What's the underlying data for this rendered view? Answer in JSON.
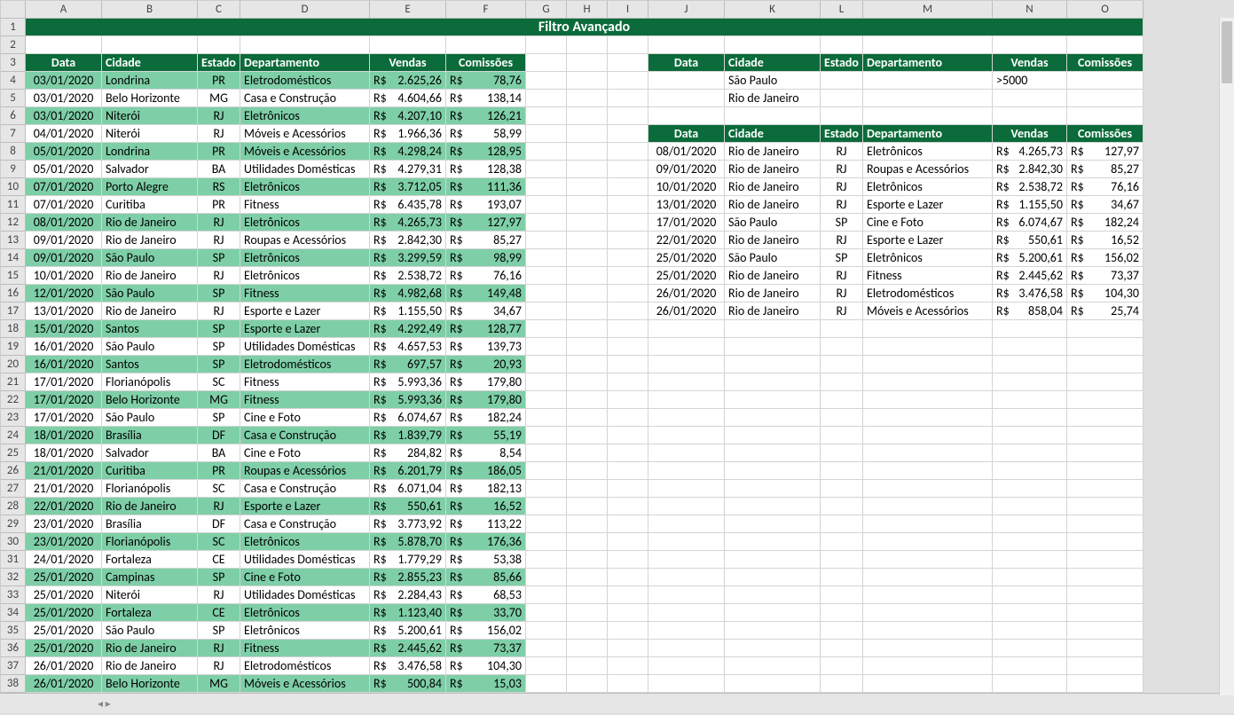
{
  "title": "Filtro Avançado",
  "columns": [
    "A",
    "B",
    "C",
    "D",
    "E",
    "F",
    "G",
    "H",
    "I",
    "J",
    "K",
    "L",
    "M",
    "N",
    "O"
  ],
  "rowCount": 38,
  "headers": [
    "Data",
    "Cidade",
    "Estado",
    "Departamento",
    "Vendas",
    "Comissões"
  ],
  "mainRows": [
    {
      "date": "03/01/2020",
      "city": "Londrina",
      "state": "PR",
      "dept": "Eletrodomésticos",
      "sales": "2.625,26",
      "comm": "78,76",
      "g": true
    },
    {
      "date": "03/01/2020",
      "city": "Belo Horizonte",
      "state": "MG",
      "dept": "Casa e Construção",
      "sales": "4.604,66",
      "comm": "138,14",
      "g": false
    },
    {
      "date": "03/01/2020",
      "city": "Niterói",
      "state": "RJ",
      "dept": "Eletrônicos",
      "sales": "4.207,10",
      "comm": "126,21",
      "g": true
    },
    {
      "date": "04/01/2020",
      "city": "Niterói",
      "state": "RJ",
      "dept": "Móveis e Acessórios",
      "sales": "1.966,36",
      "comm": "58,99",
      "g": false
    },
    {
      "date": "05/01/2020",
      "city": "Londrina",
      "state": "PR",
      "dept": "Móveis e Acessórios",
      "sales": "4.298,24",
      "comm": "128,95",
      "g": true
    },
    {
      "date": "05/01/2020",
      "city": "Salvador",
      "state": "BA",
      "dept": "Utilidades Domésticas",
      "sales": "4.279,31",
      "comm": "128,38",
      "g": false
    },
    {
      "date": "07/01/2020",
      "city": "Porto Alegre",
      "state": "RS",
      "dept": "Eletrônicos",
      "sales": "3.712,05",
      "comm": "111,36",
      "g": true
    },
    {
      "date": "07/01/2020",
      "city": "Curitiba",
      "state": "PR",
      "dept": "Fitness",
      "sales": "6.435,78",
      "comm": "193,07",
      "g": false
    },
    {
      "date": "08/01/2020",
      "city": "Rio de Janeiro",
      "state": "RJ",
      "dept": "Eletrônicos",
      "sales": "4.265,73",
      "comm": "127,97",
      "g": true
    },
    {
      "date": "09/01/2020",
      "city": "Rio de Janeiro",
      "state": "RJ",
      "dept": "Roupas e Acessórios",
      "sales": "2.842,30",
      "comm": "85,27",
      "g": false
    },
    {
      "date": "09/01/2020",
      "city": "São Paulo",
      "state": "SP",
      "dept": "Eletrônicos",
      "sales": "3.299,59",
      "comm": "98,99",
      "g": true
    },
    {
      "date": "10/01/2020",
      "city": "Rio de Janeiro",
      "state": "RJ",
      "dept": "Eletrônicos",
      "sales": "2.538,72",
      "comm": "76,16",
      "g": false
    },
    {
      "date": "12/01/2020",
      "city": "São Paulo",
      "state": "SP",
      "dept": "Fitness",
      "sales": "4.982,68",
      "comm": "149,48",
      "g": true
    },
    {
      "date": "13/01/2020",
      "city": "Rio de Janeiro",
      "state": "RJ",
      "dept": "Esporte e Lazer",
      "sales": "1.155,50",
      "comm": "34,67",
      "g": false
    },
    {
      "date": "15/01/2020",
      "city": "Santos",
      "state": "SP",
      "dept": "Esporte e Lazer",
      "sales": "4.292,49",
      "comm": "128,77",
      "g": true
    },
    {
      "date": "16/01/2020",
      "city": "São Paulo",
      "state": "SP",
      "dept": "Utilidades Domésticas",
      "sales": "4.657,53",
      "comm": "139,73",
      "g": false
    },
    {
      "date": "16/01/2020",
      "city": "Santos",
      "state": "SP",
      "dept": "Eletrodomésticos",
      "sales": "697,57",
      "comm": "20,93",
      "g": true
    },
    {
      "date": "17/01/2020",
      "city": "Florianópolis",
      "state": "SC",
      "dept": "Fitness",
      "sales": "5.993,36",
      "comm": "179,80",
      "g": false
    },
    {
      "date": "17/01/2020",
      "city": "Belo Horizonte",
      "state": "MG",
      "dept": "Fitness",
      "sales": "5.993,36",
      "comm": "179,80",
      "g": true
    },
    {
      "date": "17/01/2020",
      "city": "São Paulo",
      "state": "SP",
      "dept": "Cine e Foto",
      "sales": "6.074,67",
      "comm": "182,24",
      "g": false
    },
    {
      "date": "18/01/2020",
      "city": "Brasília",
      "state": "DF",
      "dept": "Casa e Construção",
      "sales": "1.839,79",
      "comm": "55,19",
      "g": true
    },
    {
      "date": "18/01/2020",
      "city": "Salvador",
      "state": "BA",
      "dept": "Cine e Foto",
      "sales": "284,82",
      "comm": "8,54",
      "g": false
    },
    {
      "date": "21/01/2020",
      "city": "Curitiba",
      "state": "PR",
      "dept": "Roupas e Acessórios",
      "sales": "6.201,79",
      "comm": "186,05",
      "g": true
    },
    {
      "date": "21/01/2020",
      "city": "Florianópolis",
      "state": "SC",
      "dept": "Casa e Construção",
      "sales": "6.071,04",
      "comm": "182,13",
      "g": false
    },
    {
      "date": "22/01/2020",
      "city": "Rio de Janeiro",
      "state": "RJ",
      "dept": "Esporte e Lazer",
      "sales": "550,61",
      "comm": "16,52",
      "g": true
    },
    {
      "date": "23/01/2020",
      "city": "Brasília",
      "state": "DF",
      "dept": "Casa e Construção",
      "sales": "3.773,92",
      "comm": "113,22",
      "g": false
    },
    {
      "date": "23/01/2020",
      "city": "Florianópolis",
      "state": "SC",
      "dept": "Eletrônicos",
      "sales": "5.878,70",
      "comm": "176,36",
      "g": true
    },
    {
      "date": "24/01/2020",
      "city": "Fortaleza",
      "state": "CE",
      "dept": "Utilidades Domésticas",
      "sales": "1.779,29",
      "comm": "53,38",
      "g": false
    },
    {
      "date": "25/01/2020",
      "city": "Campinas",
      "state": "SP",
      "dept": "Cine e Foto",
      "sales": "2.855,23",
      "comm": "85,66",
      "g": true
    },
    {
      "date": "25/01/2020",
      "city": "Niterói",
      "state": "RJ",
      "dept": "Utilidades Domésticas",
      "sales": "2.284,43",
      "comm": "68,53",
      "g": false
    },
    {
      "date": "25/01/2020",
      "city": "Fortaleza",
      "state": "CE",
      "dept": "Eletrônicos",
      "sales": "1.123,40",
      "comm": "33,70",
      "g": true
    },
    {
      "date": "25/01/2020",
      "city": "São Paulo",
      "state": "SP",
      "dept": "Eletrônicos",
      "sales": "5.200,61",
      "comm": "156,02",
      "g": false
    },
    {
      "date": "25/01/2020",
      "city": "Rio de Janeiro",
      "state": "RJ",
      "dept": "Fitness",
      "sales": "2.445,62",
      "comm": "73,37",
      "g": true
    },
    {
      "date": "26/01/2020",
      "city": "Rio de Janeiro",
      "state": "RJ",
      "dept": "Eletrodomésticos",
      "sales": "3.476,58",
      "comm": "104,30",
      "g": false
    },
    {
      "date": "26/01/2020",
      "city": "Belo Horizonte",
      "state": "MG",
      "dept": "Móveis e Acessórios",
      "sales": "500,84",
      "comm": "15,03",
      "g": true
    }
  ],
  "criteria": [
    {
      "city": "São Paulo",
      "sales": ">5000"
    },
    {
      "city": "Rio de Janeiro",
      "sales": ""
    }
  ],
  "resultRows": [
    {
      "date": "08/01/2020",
      "city": "Rio de Janeiro",
      "state": "RJ",
      "dept": "Eletrônicos",
      "sales": "4.265,73",
      "comm": "127,97"
    },
    {
      "date": "09/01/2020",
      "city": "Rio de Janeiro",
      "state": "RJ",
      "dept": "Roupas e Acessórios",
      "sales": "2.842,30",
      "comm": "85,27"
    },
    {
      "date": "10/01/2020",
      "city": "Rio de Janeiro",
      "state": "RJ",
      "dept": "Eletrônicos",
      "sales": "2.538,72",
      "comm": "76,16"
    },
    {
      "date": "13/01/2020",
      "city": "Rio de Janeiro",
      "state": "RJ",
      "dept": "Esporte e Lazer",
      "sales": "1.155,50",
      "comm": "34,67"
    },
    {
      "date": "17/01/2020",
      "city": "São Paulo",
      "state": "SP",
      "dept": "Cine e Foto",
      "sales": "6.074,67",
      "comm": "182,24"
    },
    {
      "date": "22/01/2020",
      "city": "Rio de Janeiro",
      "state": "RJ",
      "dept": "Esporte e Lazer",
      "sales": "550,61",
      "comm": "16,52"
    },
    {
      "date": "25/01/2020",
      "city": "São Paulo",
      "state": "SP",
      "dept": "Eletrônicos",
      "sales": "5.200,61",
      "comm": "156,02"
    },
    {
      "date": "25/01/2020",
      "city": "Rio de Janeiro",
      "state": "RJ",
      "dept": "Fitness",
      "sales": "2.445,62",
      "comm": "73,37"
    },
    {
      "date": "26/01/2020",
      "city": "Rio de Janeiro",
      "state": "RJ",
      "dept": "Eletrodomésticos",
      "sales": "3.476,58",
      "comm": "104,30"
    },
    {
      "date": "26/01/2020",
      "city": "Rio de Janeiro",
      "state": "RJ",
      "dept": "Móveis e Acessórios",
      "sales": "858,04",
      "comm": "25,74"
    }
  ],
  "currency": "R$"
}
